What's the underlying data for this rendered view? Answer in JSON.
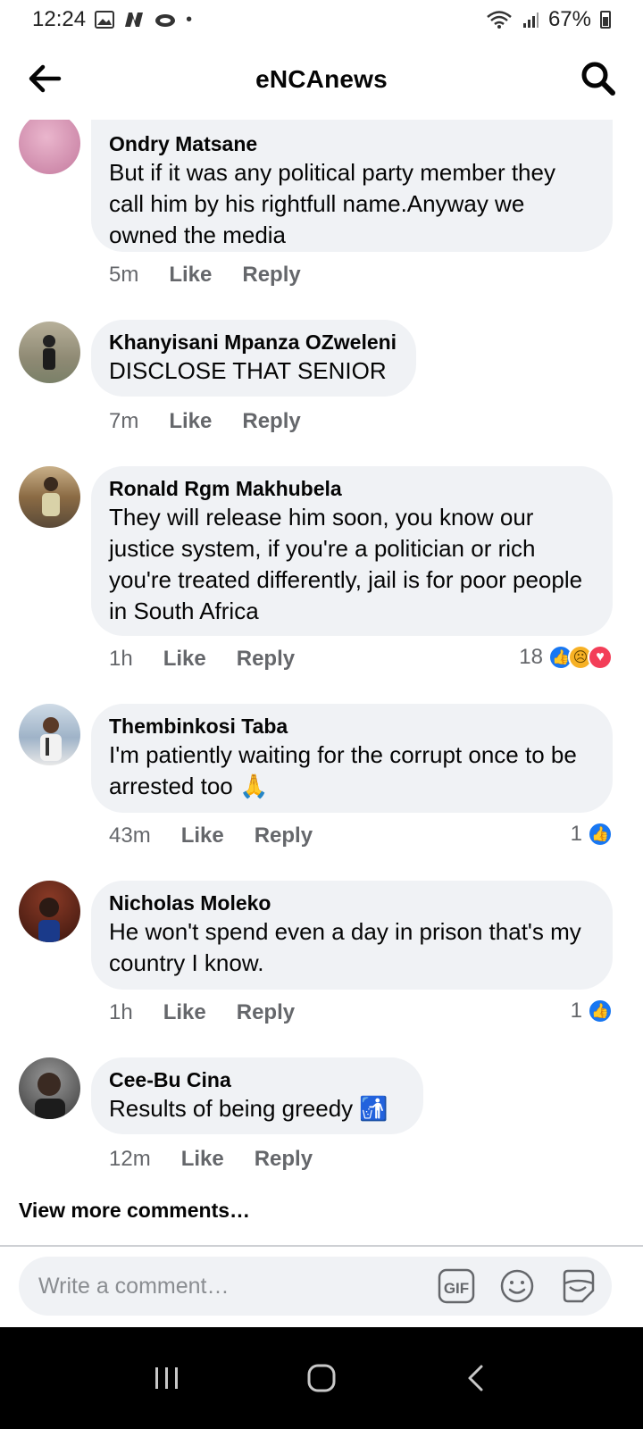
{
  "status_bar": {
    "time": "12:24",
    "battery": "67%",
    "dot": "•"
  },
  "header": {
    "title": "eNCAnews"
  },
  "comments": [
    {
      "author": "Ondry Matsane",
      "text": "But if it was any political party member they call him by his rightfull name.Anyway we owned the media",
      "time": "5m",
      "like": "Like",
      "reply": "Reply",
      "reaction_count": "",
      "avatar_color": "#d89ab8"
    },
    {
      "author": "Khanyisani Mpanza OZweleni",
      "text": "DISCLOSE THAT SENIOR",
      "time": "7m",
      "like": "Like",
      "reply": "Reply",
      "reaction_count": "",
      "avatar_color": "#8a8f7a"
    },
    {
      "author": "Ronald Rgm Makhubela",
      "text": "They will release him soon, you know our justice system, if you're a politician or rich you're treated differently, jail is for poor people in South Africa",
      "time": "1h",
      "like": "Like",
      "reply": "Reply",
      "reaction_count": "18",
      "avatar_color": "#7a6a52"
    },
    {
      "author": "Thembinkosi Taba",
      "text": "I'm patiently waiting for the corrupt once  to be arrested too 🙏",
      "time": "43m",
      "like": "Like",
      "reply": "Reply",
      "reaction_count": "1",
      "avatar_color": "#9fb3c8"
    },
    {
      "author": "Nicholas Moleko",
      "text": "He won't spend even a day in prison that's my country I know.",
      "time": "1h",
      "like": "Like",
      "reply": "Reply",
      "reaction_count": "1",
      "avatar_color": "#6b2a1e"
    },
    {
      "author": "Cee-Bu Cina",
      "text": "Results of being greedy 🚮",
      "time": "12m",
      "like": "Like",
      "reply": "Reply",
      "reaction_count": "",
      "avatar_color": "#4a4a4a"
    }
  ],
  "view_more": "View more comments…",
  "composer": {
    "placeholder": "Write a comment…"
  },
  "colors": {
    "bubble": "#f0f2f5",
    "meta_text": "#65676b",
    "like_blue": "#1877f2"
  }
}
